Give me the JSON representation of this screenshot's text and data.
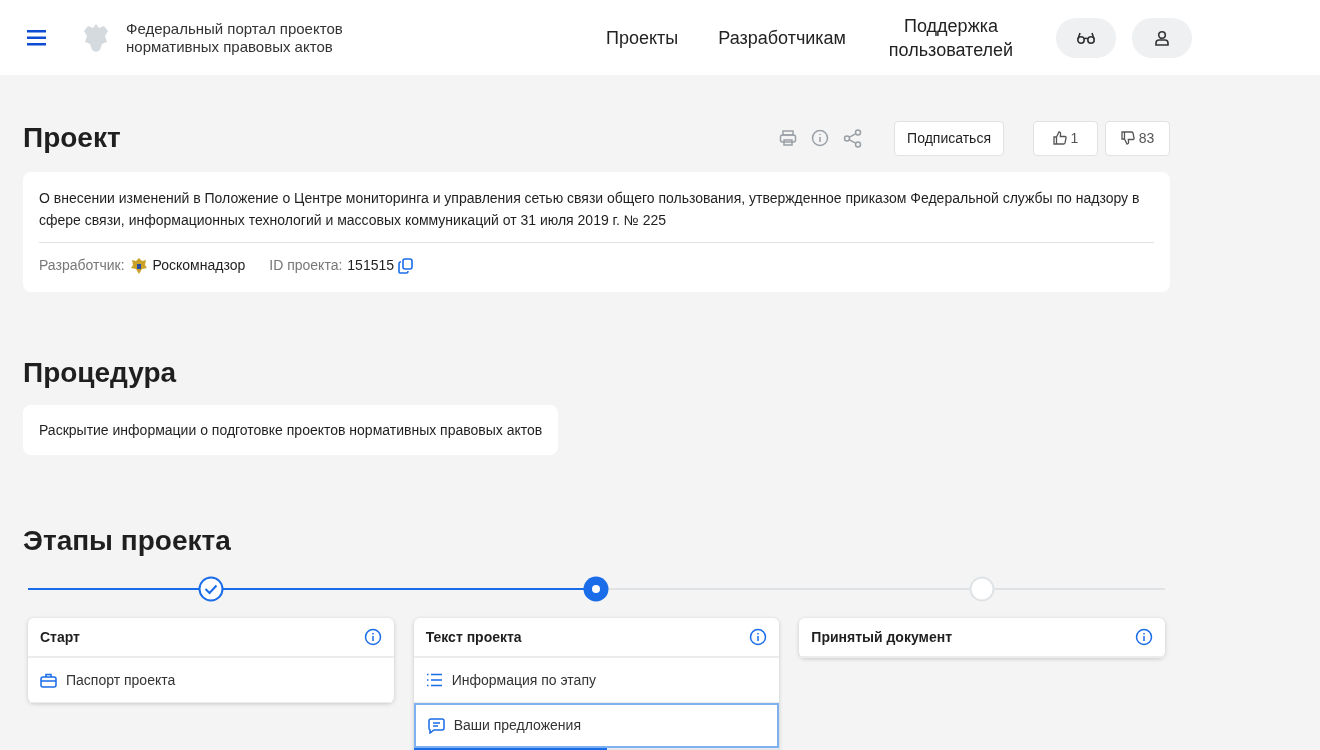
{
  "header": {
    "site_title": "Федеральный портал проектов нормативных правовых актов",
    "nav": [
      {
        "label": "Проекты"
      },
      {
        "label": "Разработчикам"
      },
      {
        "label": "Поддержка пользователей"
      }
    ]
  },
  "project": {
    "heading": "Проект",
    "subscribe": "Подписаться",
    "likes": "1",
    "dislikes": "83",
    "description": "О внесении изменений в Положение о Центре мониторинга и управления сетью связи общего пользования, утвержденное приказом Федеральной службы по надзору в сфере связи, информационных технологий и массовых коммуникаций от 31 июля 2019 г. № 225",
    "developer_label": "Разработчик:",
    "developer": "Роскомнадзор",
    "id_label": "ID проекта:",
    "id": "151515"
  },
  "procedure": {
    "heading": "Процедура",
    "text": "Раскрытие информации о подготовке проектов нормативных правовых актов"
  },
  "stages": {
    "heading": "Этапы проекта",
    "items": [
      {
        "title": "Старт",
        "completed": true,
        "current": false,
        "items": [
          {
            "kind": "briefcase",
            "label": "Паспорт проекта",
            "selected": false
          }
        ]
      },
      {
        "title": "Текст проекта",
        "completed": false,
        "current": true,
        "items": [
          {
            "kind": "list",
            "label": "Информация по этапу",
            "selected": false
          },
          {
            "kind": "comment",
            "label": "Ваши предложения",
            "selected": true,
            "level": 0.53
          }
        ]
      },
      {
        "title": "Принятый документ",
        "completed": false,
        "current": false
      }
    ]
  }
}
